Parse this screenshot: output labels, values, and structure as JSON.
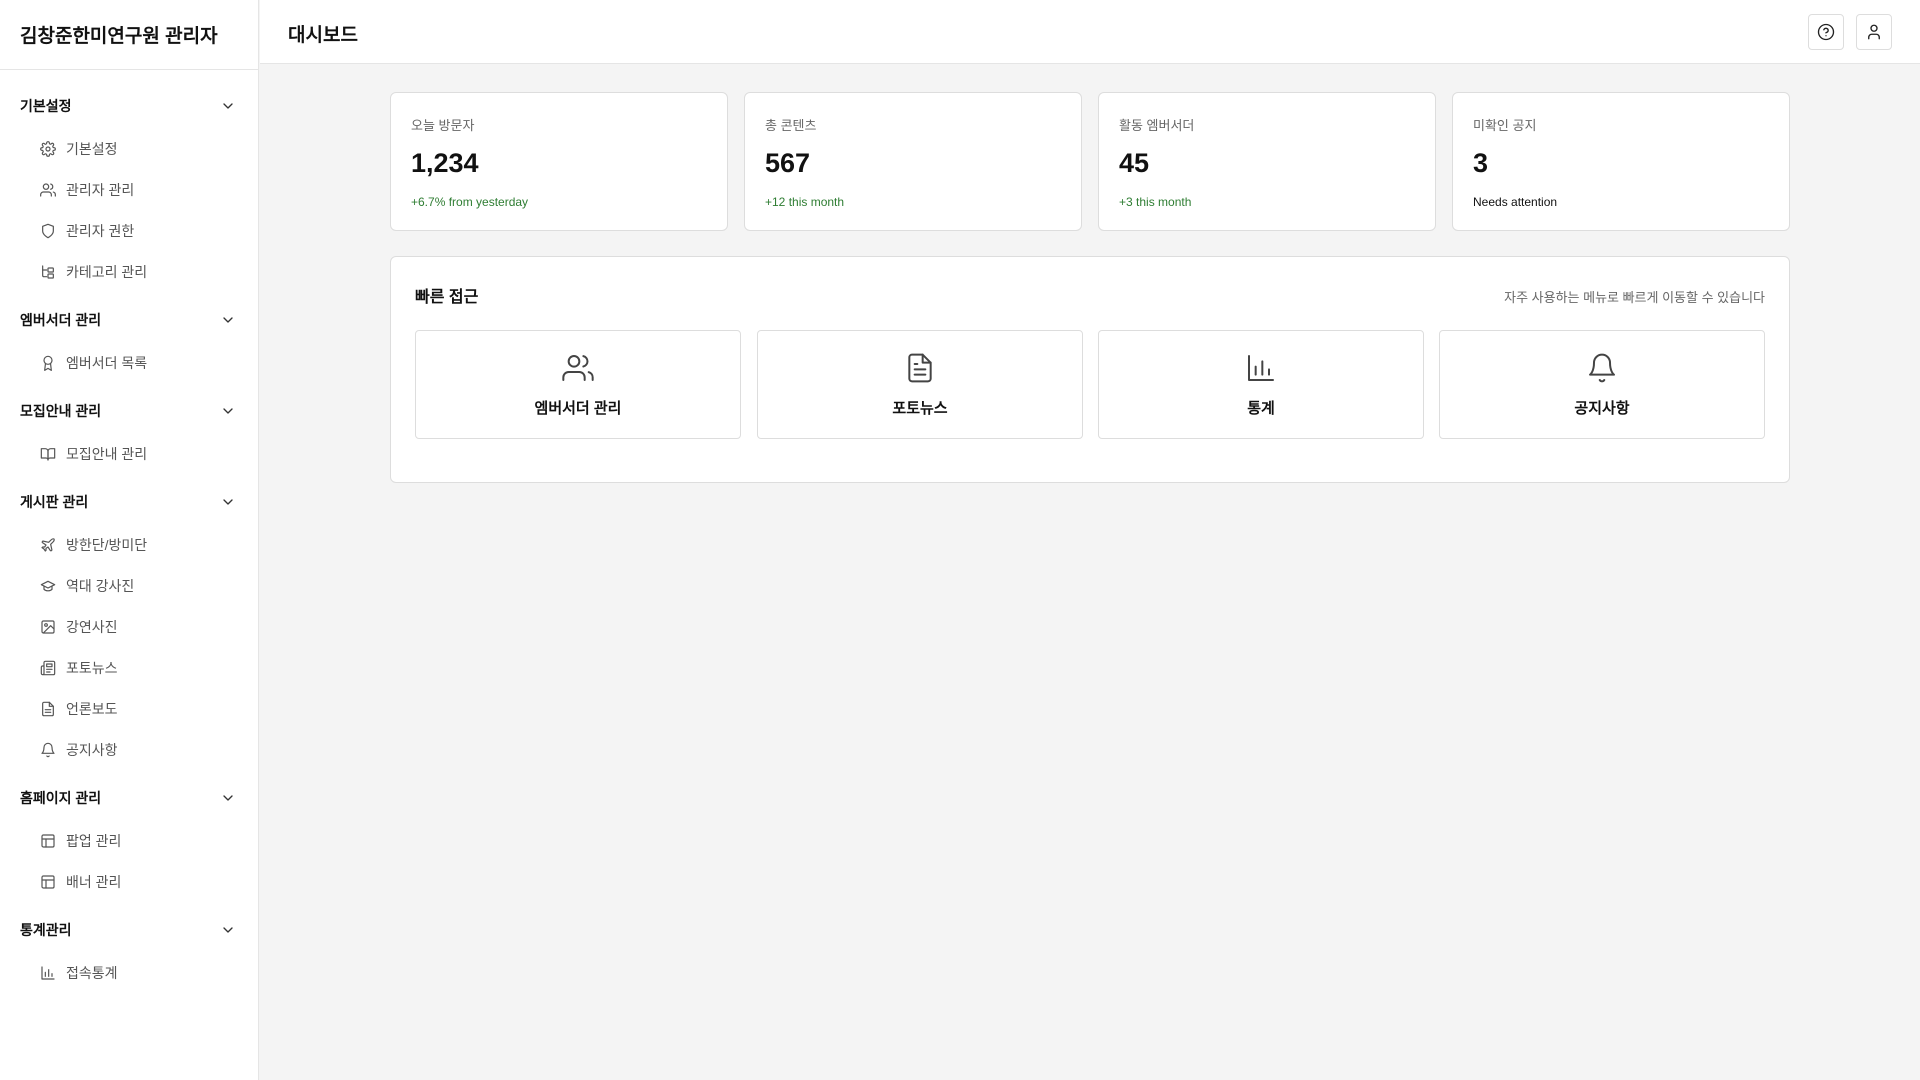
{
  "brand": {
    "title": "김창준한미연구원 관리자"
  },
  "sidebar": {
    "groups": [
      {
        "label": "기본설정",
        "items": [
          {
            "label": "기본설정",
            "icon": "gear-icon"
          },
          {
            "label": "관리자 관리",
            "icon": "users-icon"
          },
          {
            "label": "관리자 권한",
            "icon": "shield-icon"
          },
          {
            "label": "카테고리 관리",
            "icon": "tree-icon"
          }
        ]
      },
      {
        "label": "엠버서더 관리",
        "items": [
          {
            "label": "엠버서더 목록",
            "icon": "award-icon"
          }
        ]
      },
      {
        "label": "모집안내 관리",
        "items": [
          {
            "label": "모집안내 관리",
            "icon": "book-icon"
          }
        ]
      },
      {
        "label": "게시판 관리",
        "items": [
          {
            "label": "방한단/방미단",
            "icon": "plane-icon"
          },
          {
            "label": "역대 강사진",
            "icon": "graduation-cap-icon"
          },
          {
            "label": "강연사진",
            "icon": "image-icon"
          },
          {
            "label": "포토뉴스",
            "icon": "newspaper-icon"
          },
          {
            "label": "언론보도",
            "icon": "document-icon"
          },
          {
            "label": "공지사항",
            "icon": "bell-icon"
          }
        ]
      },
      {
        "label": "홈페이지 관리",
        "items": [
          {
            "label": "팝업 관리",
            "icon": "layout-icon"
          },
          {
            "label": "배너 관리",
            "icon": "layout-icon"
          }
        ]
      },
      {
        "label": "통계관리",
        "items": [
          {
            "label": "접속통계",
            "icon": "bar-chart-icon"
          }
        ]
      }
    ]
  },
  "header": {
    "title": "대시보드"
  },
  "stats": [
    {
      "label": "오늘 방문자",
      "value": "1,234",
      "note": "+6.7% from yesterday",
      "note_color": "#2e7d32"
    },
    {
      "label": "총 콘텐츠",
      "value": "567",
      "note": "+12 this month",
      "note_color": "#2e7d32"
    },
    {
      "label": "활동 엠버서더",
      "value": "45",
      "note": "+3 this month",
      "note_color": "#2e7d32"
    },
    {
      "label": "미확인 공지",
      "value": "3",
      "note": "Needs attention",
      "note_color": "#111111"
    }
  ],
  "quick": {
    "title": "빠른 접근",
    "description": "자주 사용하는 메뉴로 빠르게 이동할 수 있습니다",
    "cards": [
      {
        "label": "엠버서더 관리",
        "icon": "users-icon"
      },
      {
        "label": "포토뉴스",
        "icon": "document-icon"
      },
      {
        "label": "통계",
        "icon": "bar-chart-icon"
      },
      {
        "label": "공지사항",
        "icon": "bell-icon"
      }
    ]
  }
}
